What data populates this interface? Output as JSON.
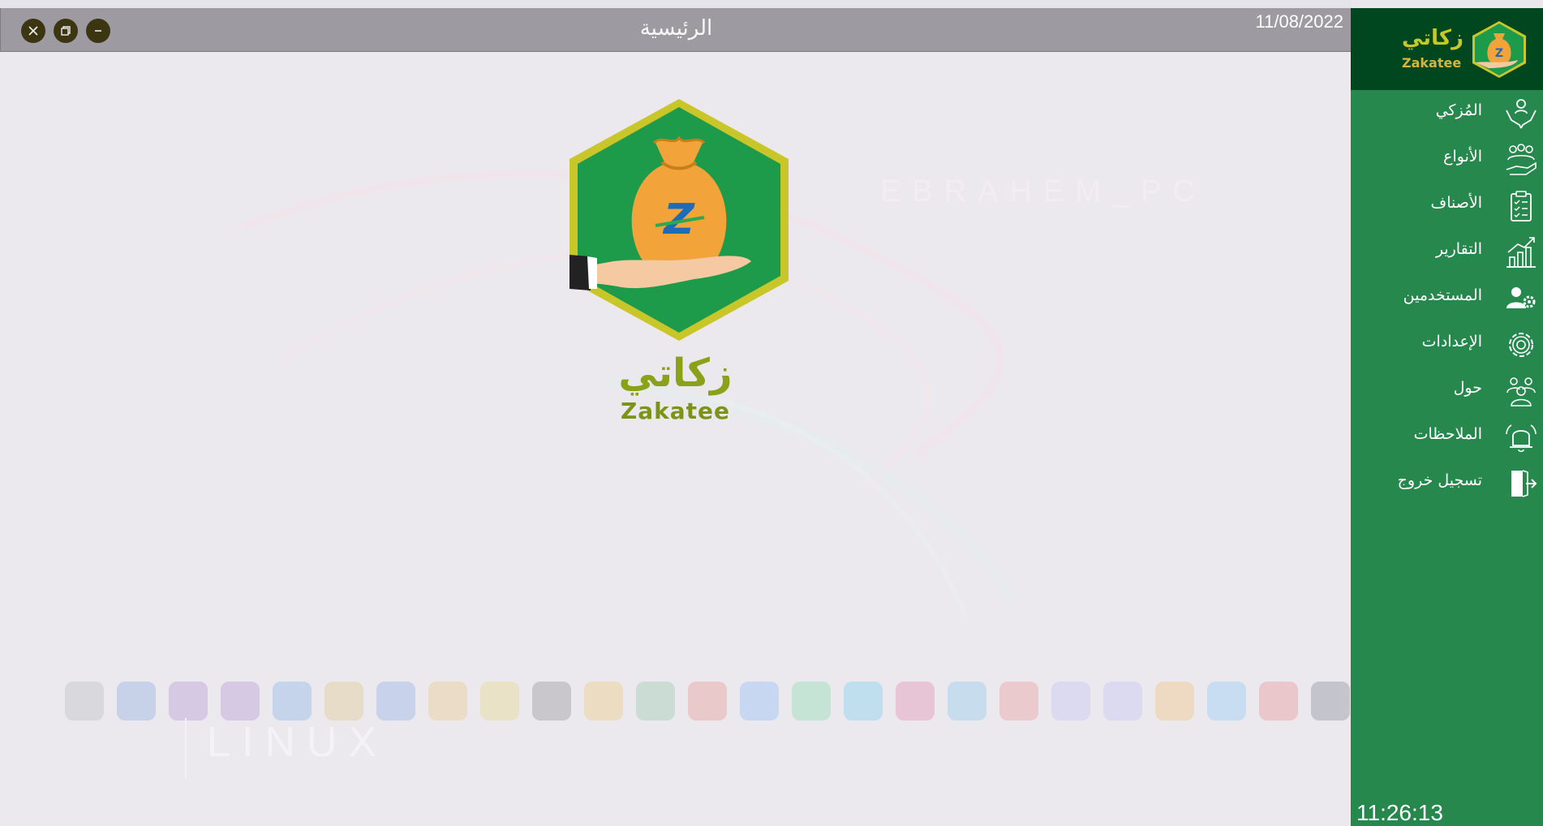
{
  "window": {
    "title": "الرئيسية",
    "date": "11/08/2022",
    "controls": [
      "close",
      "restore",
      "minimize"
    ]
  },
  "brand": {
    "name_ar": "زكاتي",
    "name_en": "Zakatee",
    "colors": {
      "green": "#1e9a4b",
      "gold": "#c6c72a",
      "orange": "#f2a33a"
    }
  },
  "watermark": {
    "pc_name": "EBRAHEM_PC",
    "os_label": "LINUX"
  },
  "sidebar": {
    "items": [
      {
        "label": "المُزكي",
        "icon": "hands-donor-icon"
      },
      {
        "label": "الأنواع",
        "icon": "people-hand-icon"
      },
      {
        "label": "الأصناف",
        "icon": "clipboard-checklist-icon"
      },
      {
        "label": "التقارير",
        "icon": "bar-chart-icon"
      },
      {
        "label": "المستخدمين",
        "icon": "users-gear-icon"
      },
      {
        "label": "الإعدادات",
        "icon": "gear-icon"
      },
      {
        "label": "حول",
        "icon": "group-icon"
      },
      {
        "label": "الملاحظات",
        "icon": "bell-icon"
      },
      {
        "label": "تسجيل خروج",
        "icon": "logout-door-icon"
      }
    ],
    "clock": "11:26:13"
  }
}
